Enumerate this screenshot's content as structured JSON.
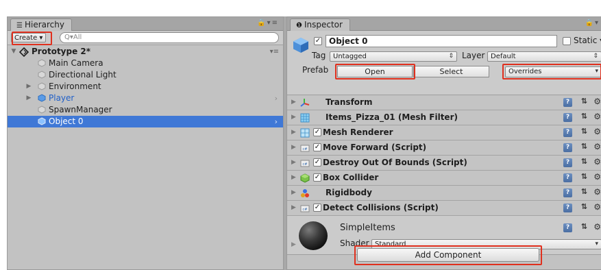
{
  "hierarchy": {
    "tab_label": "Hierarchy",
    "create_label": "Create ▾",
    "search_placeholder": "Q▾All",
    "scene_name": "Prototype 2*",
    "items": [
      {
        "label": "Main Camera"
      },
      {
        "label": "Directional Light"
      },
      {
        "label": "Environment"
      },
      {
        "label": "Player"
      },
      {
        "label": "SpawnManager"
      },
      {
        "label": "Object 0"
      }
    ]
  },
  "inspector": {
    "tab_label": "Inspector",
    "object_name": "Object 0",
    "static_label": "Static",
    "tag_label": "Tag",
    "tag_value": "Untagged",
    "layer_label": "Layer",
    "layer_value": "Default",
    "prefab_label": "Prefab",
    "open_label": "Open",
    "select_label": "Select",
    "overrides_label": "Overrides",
    "components": [
      {
        "name": "Transform",
        "icon": "transform-icon",
        "checkbox": false
      },
      {
        "name": "Items_Pizza_01 (Mesh Filter)",
        "icon": "mesh-filter-icon",
        "checkbox": false
      },
      {
        "name": "Mesh Renderer",
        "icon": "mesh-renderer-icon",
        "checkbox": true
      },
      {
        "name": "Move Forward (Script)",
        "icon": "script-icon",
        "checkbox": true
      },
      {
        "name": "Destroy Out Of Bounds (Script)",
        "icon": "script-icon",
        "checkbox": true
      },
      {
        "name": "Box Collider",
        "icon": "box-collider-icon",
        "checkbox": true
      },
      {
        "name": "Rigidbody",
        "icon": "rigidbody-icon",
        "checkbox": false
      },
      {
        "name": "Detect Collisions (Script)",
        "icon": "script-icon",
        "checkbox": true
      }
    ],
    "material": {
      "name": "SimpleItems",
      "shader_label": "Shader",
      "shader_value": "Standard"
    },
    "add_component_label": "Add Component"
  },
  "colors": {
    "selection": "#3f78d6",
    "panel": "#c2c2c2",
    "highlight_box": "#e0301e"
  }
}
